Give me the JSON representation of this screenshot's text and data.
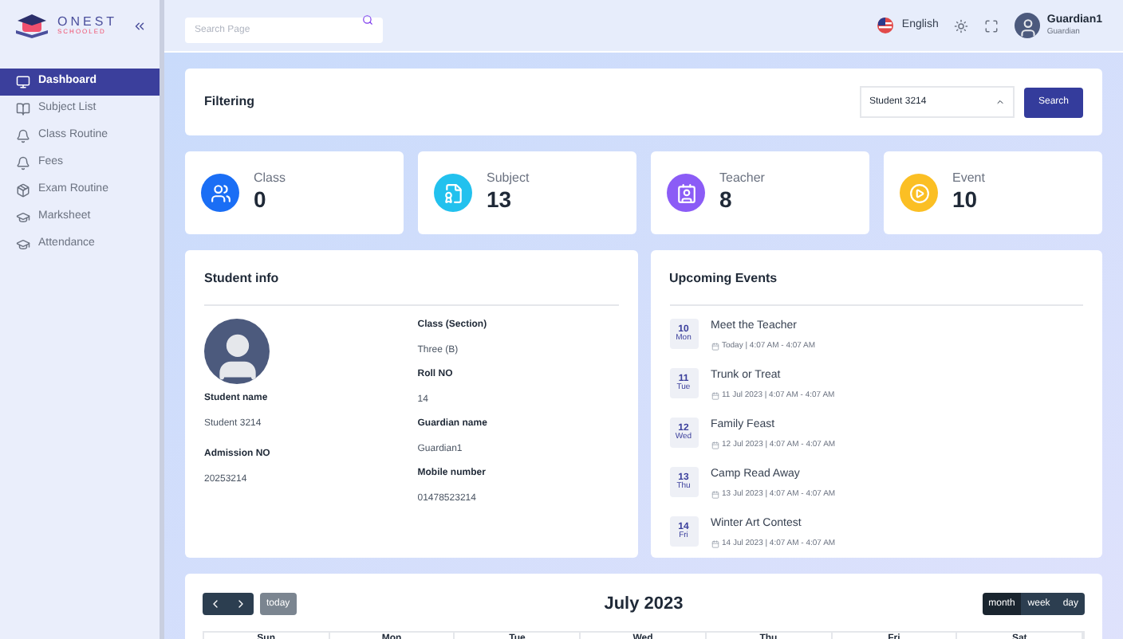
{
  "logo": {
    "name": "ONEST",
    "tagline": "SCHOOLED"
  },
  "sidebar": {
    "items": [
      {
        "label": "Dashboard",
        "selected": true
      },
      {
        "label": "Subject List",
        "selected": false
      },
      {
        "label": "Class Routine",
        "selected": false
      },
      {
        "label": "Fees",
        "selected": false
      },
      {
        "label": "Exam Routine",
        "selected": false
      },
      {
        "label": "Marksheet",
        "selected": false
      },
      {
        "label": "Attendance",
        "selected": false
      }
    ]
  },
  "header": {
    "search": {
      "placeholder": "Search Page"
    },
    "language": "English",
    "user": {
      "name": "Guardian1",
      "role": "Guardian"
    }
  },
  "filtering": {
    "title": "Filtering",
    "student_select": "Student 3214",
    "button": "Search"
  },
  "stats": [
    {
      "label": "Class",
      "value": "0",
      "color": "#1a6ef5"
    },
    {
      "label": "Subject",
      "value": "13",
      "color": "#22c1ee"
    },
    {
      "label": "Teacher",
      "value": "8",
      "color": "#8b5cf6"
    },
    {
      "label": "Event",
      "value": "10",
      "color": "#fbbf24"
    }
  ],
  "student_info": {
    "title": "Student info",
    "left": [
      {
        "label": "Student name",
        "value": "Student 3214"
      },
      {
        "label": "Admission NO",
        "value": "20253214"
      }
    ],
    "right": [
      {
        "label": "Class (Section)",
        "value": "Three (B)"
      },
      {
        "label": "Roll NO",
        "value": "14"
      },
      {
        "label": "Guardian name",
        "value": "Guardian1"
      },
      {
        "label": "Mobile number",
        "value": "01478523214"
      }
    ]
  },
  "upcoming_events": {
    "title": "Upcoming Events",
    "items": [
      {
        "day": "10",
        "weekday": "Mon",
        "title": "Meet the Teacher",
        "time": "Today | 4:07 AM - 4:07 AM"
      },
      {
        "day": "11",
        "weekday": "Tue",
        "title": "Trunk or Treat",
        "time": "11 Jul 2023 | 4:07 AM - 4:07 AM"
      },
      {
        "day": "12",
        "weekday": "Wed",
        "title": "Family Feast",
        "time": "12 Jul 2023 | 4:07 AM - 4:07 AM"
      },
      {
        "day": "13",
        "weekday": "Thu",
        "title": "Camp Read Away",
        "time": "13 Jul 2023 | 4:07 AM - 4:07 AM"
      },
      {
        "day": "14",
        "weekday": "Fri",
        "title": "Winter Art Contest",
        "time": "14 Jul 2023 | 4:07 AM - 4:07 AM"
      }
    ]
  },
  "calendar": {
    "title": "July 2023",
    "today_button": {
      "label": "today",
      "disabled": true
    },
    "views": [
      {
        "label": "month",
        "selected": true
      },
      {
        "label": "week",
        "selected": false
      },
      {
        "label": "day",
        "selected": false
      }
    ],
    "weekdays": [
      "Sun",
      "Mon",
      "Tue",
      "Wed",
      "Thu",
      "Fri",
      "Sat"
    ]
  }
}
